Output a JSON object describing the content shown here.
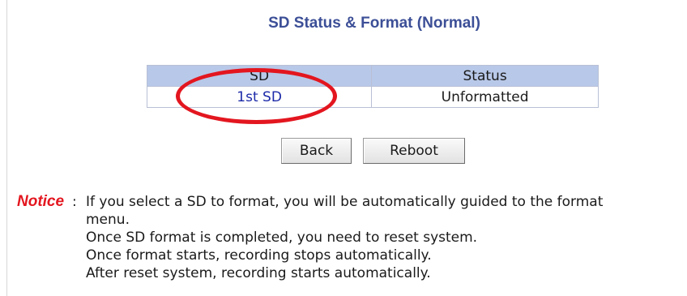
{
  "page": {
    "title": "SD Status & Format (Normal)"
  },
  "table": {
    "headers": {
      "sd": "SD",
      "status": "Status"
    },
    "rows": [
      {
        "sd": "1st SD",
        "status": "Unformatted"
      }
    ]
  },
  "buttons": {
    "back": "Back",
    "reboot": "Reboot"
  },
  "notice": {
    "label": "Notice",
    "separator": ":",
    "lines": [
      "If you select a SD to format, you will be automatically guided to the format",
      "menu.",
      "Once SD format is completed, you need to reset system.",
      "Once format starts, recording stops automatically.",
      "After reset system, recording starts automatically."
    ]
  },
  "colors": {
    "title": "#3c4f97",
    "header_bg": "#b8c8e8",
    "link": "#1c2aa8",
    "notice_label": "#e3161f",
    "annotation": "#e3161f"
  }
}
